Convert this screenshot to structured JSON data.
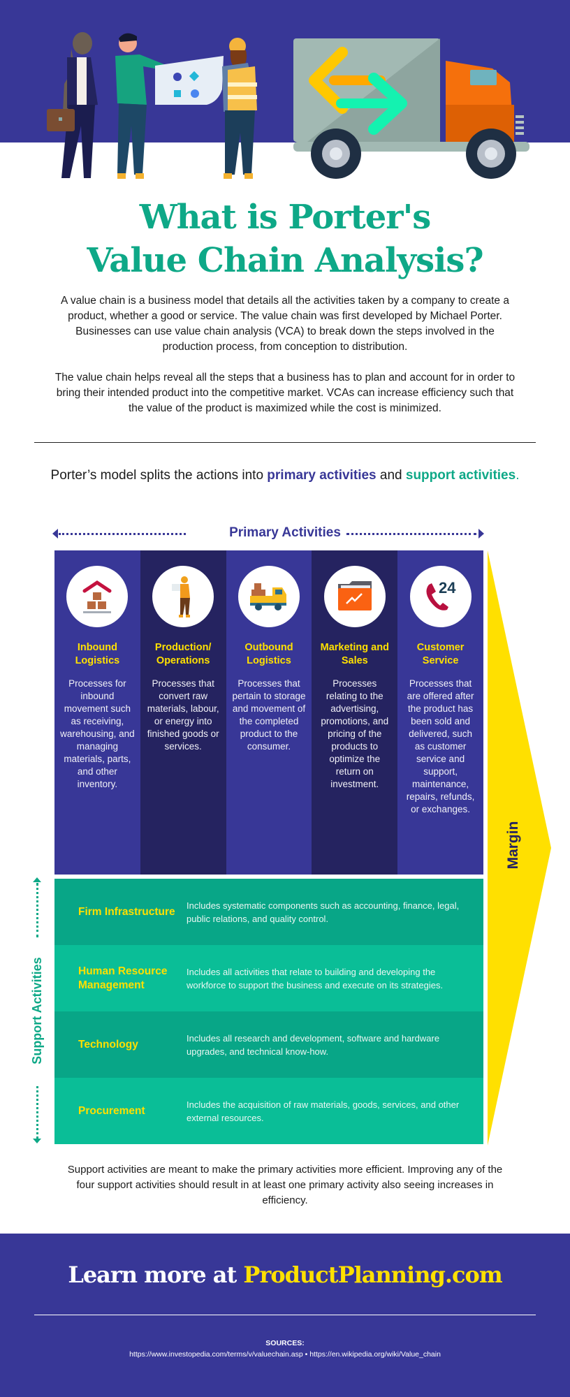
{
  "colors": {
    "brand_purple": "#383797",
    "dark_purple": "#252360",
    "teal": "#0ea887",
    "teal_dark_row": "#08a687",
    "teal_light_row": "#0abe97",
    "yellow": "#ffe000"
  },
  "hero": {
    "illustration": "people-reviewing-flowchart-and-delivery-truck"
  },
  "title": {
    "line1": "What is Porter's",
    "line2": "Value Chain Analysis?"
  },
  "intro": {
    "paragraph1": "A value chain is a business model that details all the activities taken by a company to create a product, whether a good or service. The value chain was first developed by Michael Porter. Businesses can use value chain analysis (VCA) to break down the steps involved in the production process, from conception to distribution.",
    "paragraph2": "The value chain helps reveal all the steps that a business has to plan and account for in order to bring their intended product into the competitive market. VCAs can increase efficiency such that the value of the product is maximized while the cost is minimized."
  },
  "split_sentence": {
    "prefix": "Porter’s model splits the actions into ",
    "primary": "primary activities",
    "middle": " and ",
    "support": "support activities",
    "suffix": "."
  },
  "primary": {
    "heading": "Primary Activities",
    "columns": [
      {
        "icon": "warehouse-boxes-icon",
        "title": "Inbound Logistics",
        "desc": "Processes for inbound movement such as receiving, warehousing, and managing materials, parts, and other inventory."
      },
      {
        "icon": "worker-with-blueprint-icon",
        "title": "Production/ Operations",
        "desc": "Processes that convert raw materials, labour, or energy into finished goods or services."
      },
      {
        "icon": "delivery-truck-icon",
        "title": "Outbound Logistics",
        "desc": "Processes that pertain to storage and movement of the completed product to the consumer."
      },
      {
        "icon": "folder-chart-icon",
        "title": "Marketing and Sales",
        "desc": "Processes relating to the advertising, promotions, and pricing of the products to optimize the return on investment."
      },
      {
        "icon": "phone-24-icon",
        "title": "Customer Service",
        "desc": "Processes that are offered after the product has been sold and delivered, such as customer service and support, maintenance, repairs, refunds, or exchanges."
      }
    ],
    "phone_badge": "24"
  },
  "margin_label": "Margin",
  "support": {
    "heading": "Support Activities",
    "rows": [
      {
        "title": "Firm Infrastructure",
        "desc": "Includes systematic components such as accounting, finance, legal, public relations, and quality control."
      },
      {
        "title": "Human Resource Management",
        "desc": "Includes all activities that relate to building and developing the workforce to support the business and execute on its strategies."
      },
      {
        "title": "Technology",
        "desc": "Includes all research and development, software and hardware upgrades, and technical know-how."
      },
      {
        "title": "Procurement",
        "desc": "Includes the acquisition of raw materials, goods, services, and other external resources."
      }
    ]
  },
  "outro": "Support activities are meant to make the primary activities more efficient. Improving any of the four support activities should result in at least one primary activity also seeing increases in efficiency.",
  "footer": {
    "cta_prefix": "Learn more at ",
    "cta_site": "ProductPlanning.com",
    "sources_label": "SOURCES:",
    "sources": "https://www.investopedia.com/terms/v/valuechain.asp • https://en.wikipedia.org/wiki/Value_chain"
  }
}
